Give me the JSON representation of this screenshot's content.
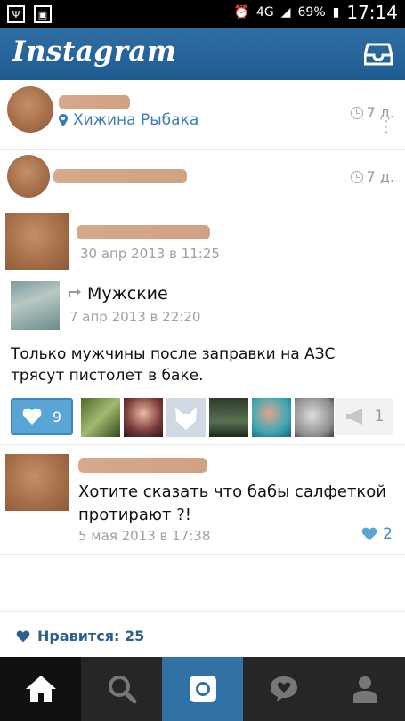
{
  "status_bar": {
    "network": "4G",
    "battery": "69%",
    "time": "17:14"
  },
  "header": {
    "title": "Instagram"
  },
  "activity": [
    {
      "place": "Хижина Рыбака",
      "time_ago": "7 д."
    },
    {
      "time_ago": "7 д."
    }
  ],
  "post": {
    "date": "30 апр 2013 в 11:25",
    "repost_label": "Мужские",
    "repost_date": "7 апр 2013 в 22:20",
    "text": "Только мужчины после заправки на АЗС трясут пистолет в баке.",
    "likes": "9",
    "shares": "1"
  },
  "comment": {
    "text": "Хотите сказать что бабы салфеткой протирают ?!",
    "date": "5 мая 2013 в 17:38",
    "likes": "2"
  },
  "footer": {
    "likes_label": "Нравится: 25"
  },
  "nav": [
    "home",
    "search",
    "camera",
    "activity",
    "profile"
  ]
}
